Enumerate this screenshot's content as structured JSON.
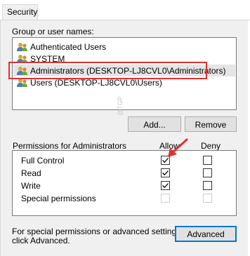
{
  "tab": {
    "label": "Security"
  },
  "group_label": "Group or user names:",
  "users": [
    {
      "label": "Authenticated Users",
      "selected": false
    },
    {
      "label": "SYSTEM",
      "selected": false
    },
    {
      "label": "Administrators (DESKTOP-LJ8CVL0\\Administrators)",
      "selected": true
    },
    {
      "label": "Users (DESKTOP-LJ8CVL0\\Users)",
      "selected": false
    }
  ],
  "buttons": {
    "add": "Add...",
    "remove": "Remove",
    "advanced": "Advanced"
  },
  "permissions": {
    "header": "Permissions for Administrators",
    "allow_label": "Allow",
    "deny_label": "Deny",
    "rows": [
      {
        "label": "Full Control",
        "allow": true,
        "deny": false,
        "enabled": true
      },
      {
        "label": "Read",
        "allow": true,
        "deny": false,
        "enabled": true
      },
      {
        "label": "Write",
        "allow": true,
        "deny": false,
        "enabled": true
      },
      {
        "label": "Special permissions",
        "allow": false,
        "deny": false,
        "enabled": false
      }
    ]
  },
  "footer_text_line1": "For special permissions or advanced settings,",
  "footer_text_line2": "click Advanced.",
  "annotation_color": "#e03131",
  "watermark": "@TGP"
}
